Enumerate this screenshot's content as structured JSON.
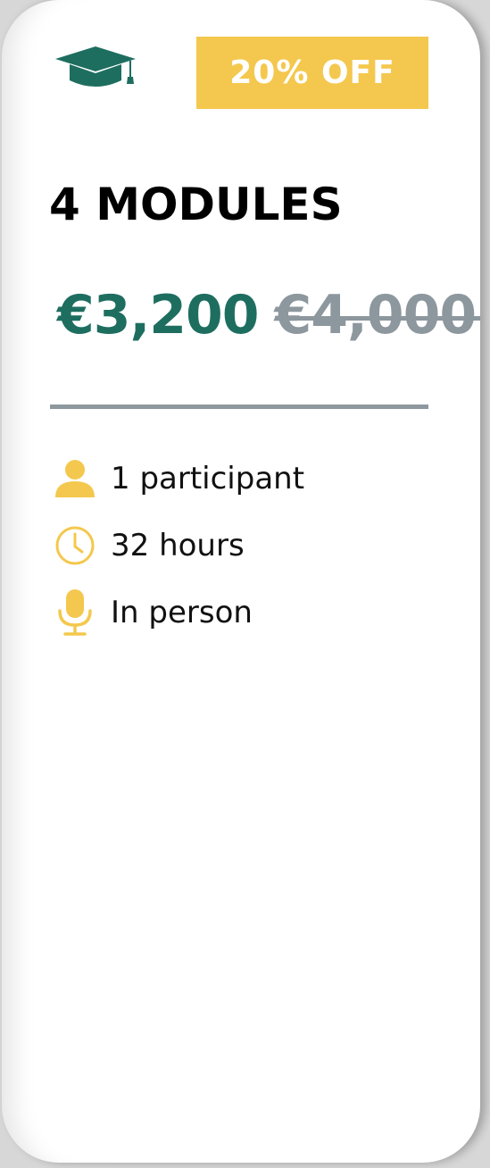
{
  "badge": {
    "label": "20% OFF"
  },
  "plan": {
    "title": "4 MODULES",
    "price_current": "€3,200",
    "price_original": "€4,000"
  },
  "features": [
    {
      "icon": "user-icon",
      "label": "1 participant"
    },
    {
      "icon": "clock-icon",
      "label": "32 hours"
    },
    {
      "icon": "microphone-icon",
      "label": "In person"
    }
  ],
  "colors": {
    "brand_green": "#1e6e60",
    "accent_yellow": "#f4c84e",
    "muted_gray": "#8d979e"
  }
}
